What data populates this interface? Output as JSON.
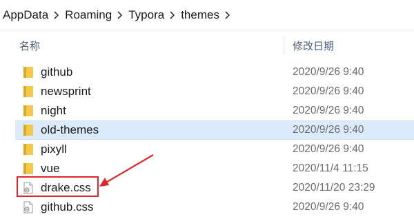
{
  "breadcrumb": [
    "AppData",
    "Roaming",
    "Typora",
    "themes"
  ],
  "columns": {
    "name": "名称",
    "date_modified": "修改日期"
  },
  "files": [
    {
      "name": "github",
      "type": "folder",
      "modified": "2020/9/26 9:40",
      "selected": false,
      "highlighted": false
    },
    {
      "name": "newsprint",
      "type": "folder",
      "modified": "2020/9/26 9:40",
      "selected": false,
      "highlighted": false
    },
    {
      "name": "night",
      "type": "folder",
      "modified": "2020/9/26 9:40",
      "selected": false,
      "highlighted": false
    },
    {
      "name": "old-themes",
      "type": "folder",
      "modified": "2020/9/26 9:40",
      "selected": true,
      "highlighted": false
    },
    {
      "name": "pixyll",
      "type": "folder",
      "modified": "2020/9/26 9:40",
      "selected": false,
      "highlighted": false
    },
    {
      "name": "vue",
      "type": "folder",
      "modified": "2020/11/4 11:15",
      "selected": false,
      "highlighted": false
    },
    {
      "name": "drake.css",
      "type": "css-file",
      "modified": "2020/11/20 23:29",
      "selected": false,
      "highlighted": true
    },
    {
      "name": "github.css",
      "type": "css-file",
      "modified": "2020/9/26 9:40",
      "selected": false,
      "highlighted": false
    }
  ],
  "colors": {
    "selection": "#dcebfb",
    "folder": "#f2c94c",
    "annotation": "#e0262a",
    "header_text": "#4c607a"
  },
  "icons": {
    "separator": "chevron-right-icon",
    "sort": "sort-ascending-icon",
    "folder": "folder-icon",
    "file": "css-file-icon"
  }
}
